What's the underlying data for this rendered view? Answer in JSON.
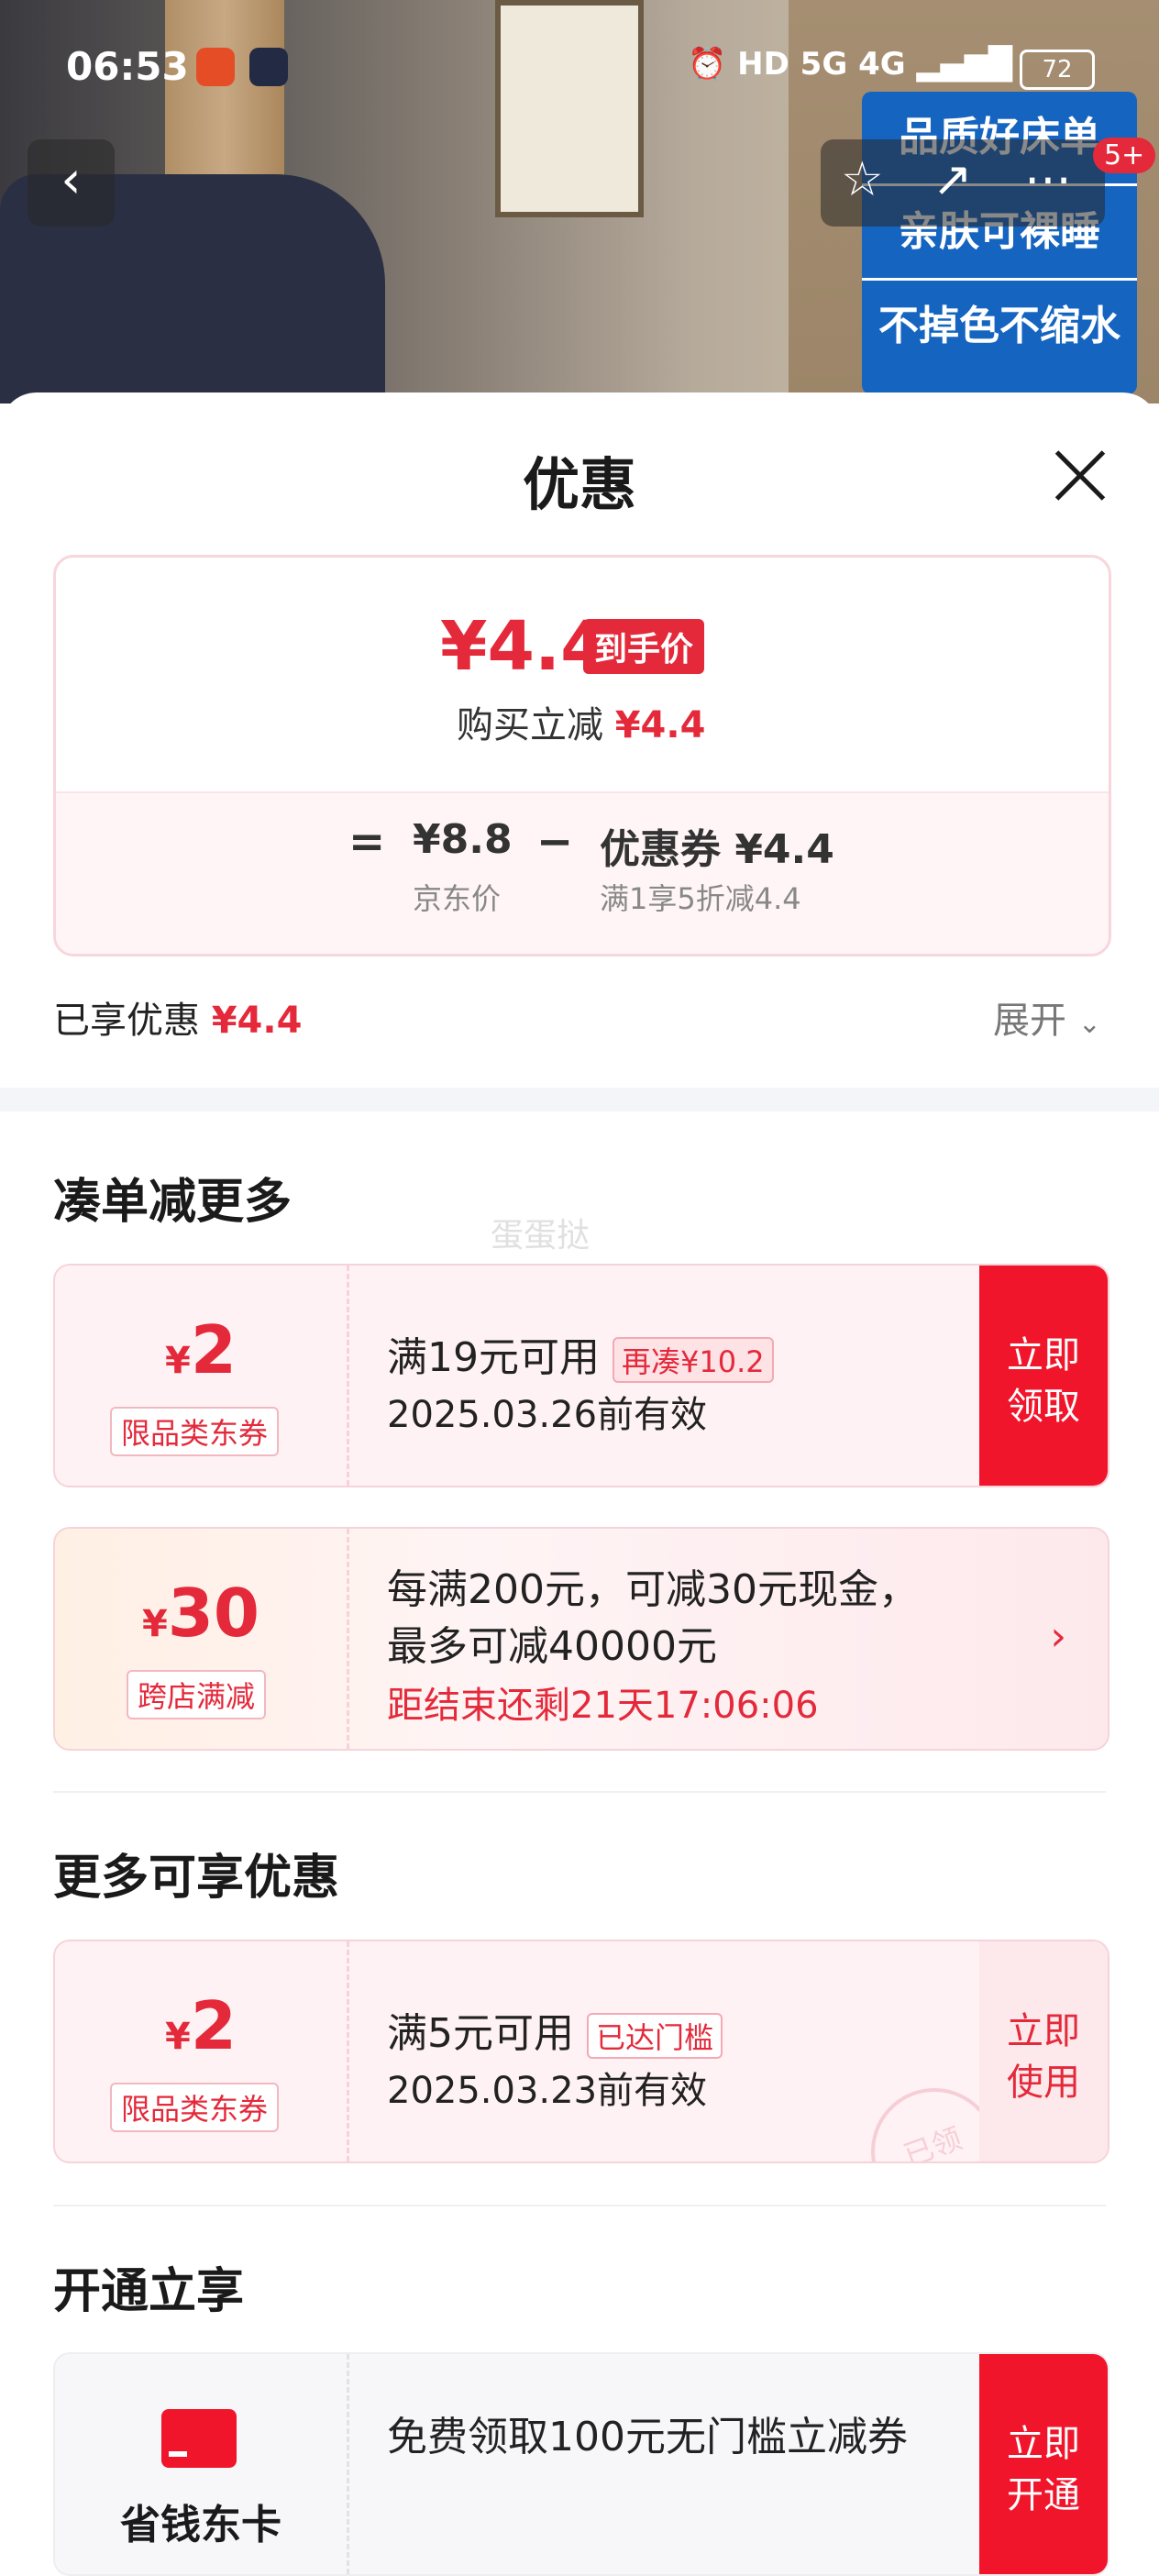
{
  "status_bar": {
    "time": "06:53",
    "network_labels": "HD 5G 4G",
    "battery": "72"
  },
  "hero": {
    "banner_lines": [
      "品质好床单",
      "亲肤可裸睡",
      "不掉色不缩水"
    ],
    "more_badge": "5+"
  },
  "sheet": {
    "title": "优惠",
    "summary": {
      "final_price": "¥4.4",
      "final_price_tag": "到手价",
      "discount_label": "购买立减",
      "discount_value": "¥4.4",
      "equals_sign": "=",
      "jd_price": "¥8.8",
      "jd_price_label": "京东价",
      "minus_sign": "−",
      "coupon_text": "优惠券 ¥4.4",
      "coupon_rule": "满1享5折减4.4"
    },
    "enjoyed_label": "已享优惠",
    "enjoyed_value": "¥4.4",
    "expand_label": "展开"
  },
  "section_more_order": {
    "title": "凑单减更多",
    "watermark": "蛋蛋挞",
    "coupon1": {
      "currency": "¥",
      "amount": "2",
      "type": "限品类东券",
      "condition": "满19元可用",
      "chip": "再凑¥10.2",
      "valid": "2025.03.26前有效",
      "action_line1": "立即",
      "action_line2": "领取"
    },
    "coupon2": {
      "currency": "¥",
      "amount": "30",
      "type": "跨店满减",
      "line1": "每满200元，可减30元现金，",
      "line2": "最多可减40000元",
      "countdown": "距结束还剩21天17:06:06",
      "arrow": "›"
    }
  },
  "section_more_available": {
    "title": "更多可享优惠",
    "coupon": {
      "currency": "¥",
      "amount": "2",
      "type": "限品类东券",
      "condition": "满5元可用",
      "chip": "已达门槛",
      "valid": "2025.03.23前有效",
      "stamp": "已领",
      "action_line1": "立即",
      "action_line2": "使用"
    }
  },
  "section_open": {
    "title": "开通立享",
    "card_name": "省钱东卡",
    "text": "免费领取100元无门槛立减券",
    "action_line1": "立即",
    "action_line2": "开通"
  },
  "colors": {
    "accent": "#e4293a",
    "action_red": "#f0152b",
    "card_bg": "#fff2f4"
  }
}
